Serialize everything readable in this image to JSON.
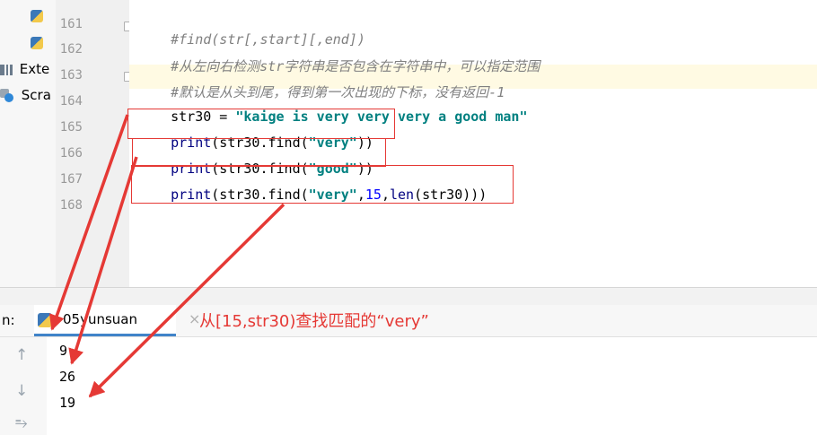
{
  "project_panel": {
    "items": [
      {
        "label": "",
        "icon": "python-file-icon"
      },
      {
        "label": "",
        "icon": "python-file-icon"
      },
      {
        "label": "Exte",
        "icon": "library-icon"
      },
      {
        "label": "Scra",
        "icon": "scratch-icon"
      }
    ]
  },
  "editor": {
    "line_numbers": [
      "161",
      "162",
      "163",
      "164",
      "165",
      "166",
      "167",
      "168"
    ],
    "lines": {
      "l161": "#find(str[,start][,end])",
      "l162": "#从左向右检测str字符串是否包含在字符串中，可以指定范围",
      "l163": "#默认是从头到尾，得到第一次出现的下标，没有返回-1",
      "l164_var": "str30",
      "l164_eq": " = ",
      "l164_str": "\"kaige is very very very a good man\"",
      "l165_fn": "print",
      "l165_a": "(str30.find(",
      "l165_str": "\"very\"",
      "l165_b": "))",
      "l166_fn": "print",
      "l166_a": "(str30.find(",
      "l166_str": "\"good\"",
      "l166_b": "))",
      "l167_fn": "print",
      "l167_a": "(str30.find(",
      "l167_str": "\"very\"",
      "l167_c": ",",
      "l167_num": "15",
      "l167_d": ",",
      "l167_len": "len",
      "l167_e": "(str30)))"
    }
  },
  "run_panel": {
    "label": "n:",
    "tab_label": "05yunsuan",
    "close_glyph": "×",
    "annotation": "从[15,str30)查找匹配的“very”",
    "tools": {
      "up": "↑",
      "down": "↓",
      "wrap": "⥱"
    },
    "output": [
      "9",
      "26",
      "19"
    ]
  },
  "colors": {
    "annotation_red": "#e53935",
    "string_teal": "#008080",
    "keyword_navy": "#000080",
    "comment_gray": "#808080",
    "current_line": "#fffae3"
  }
}
